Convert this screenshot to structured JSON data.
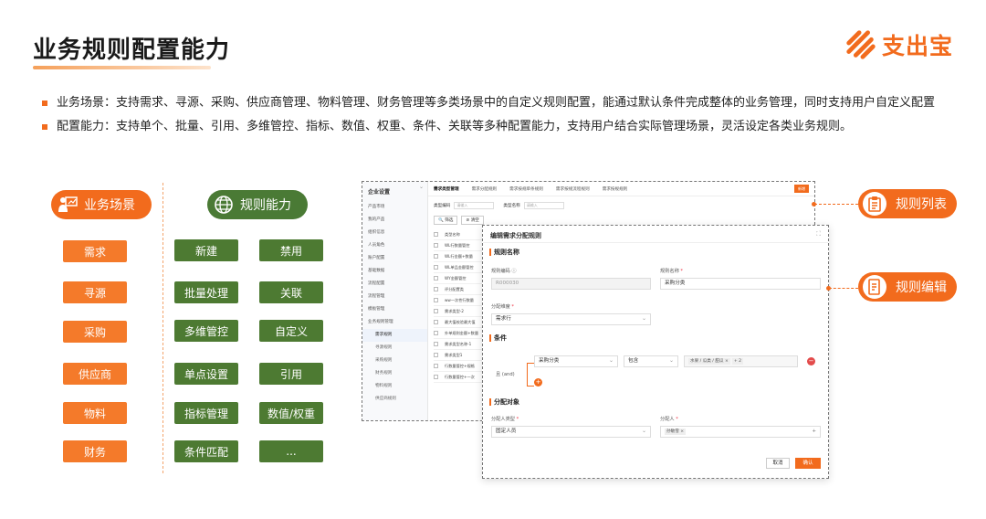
{
  "page": {
    "title": "业务规则配置能力",
    "logo_text": "支出宝"
  },
  "bullets": [
    "业务场景：支持需求、寻源、采购、供应商管理、物料管理、财务管理等多类场景中的自定义规则配置，能通过默认条件完成整体的业务管理，同时支持用户自定义配置",
    "配置能力：支持单个、批量、引用、多维管控、指标、数值、权重、条件、关联等多种配置能力，支持用户结合实际管理场景，灵活设定各类业务规则。"
  ],
  "scenes": {
    "header": "业务场景",
    "items": [
      "需求",
      "寻源",
      "采购",
      "供应商",
      "物料",
      "财务"
    ]
  },
  "capabilities": {
    "header": "规则能力",
    "left": [
      "新建",
      "批量处理",
      "多维管控",
      "单点设置",
      "指标管理",
      "条件匹配"
    ],
    "right": [
      "禁用",
      "关联",
      "自定义",
      "引用",
      "数值/权重",
      "..."
    ]
  },
  "callouts": {
    "list": "规则列表",
    "edit": "规则编辑"
  },
  "list_screen": {
    "sidebar_title": "企业设置",
    "sidebar_items": [
      "产品市场",
      "我的产品",
      "组织信息",
      "人员角色",
      "账户配置",
      "基础数据",
      "流程配置",
      "流程管理",
      "模板管理",
      "业务规则管理"
    ],
    "sidebar_sub": [
      "需求规则",
      "寻源规则",
      "采购规则",
      "财务规则",
      "物料规则",
      "供应商规则"
    ],
    "tabs": [
      "需求类型管理",
      "需求分配规则",
      "需求按规单条规则",
      "需求按规流程规则",
      "需求按规规则"
    ],
    "new_button": "新增",
    "filter_code_label": "类型编码",
    "filter_code_placeholder": "请输入",
    "filter_name_label": "类型名称",
    "filter_name_placeholder": "请输入",
    "search_button": "筛选",
    "clear_button": "清空",
    "rows": [
      "类型名称",
      "WL行数量管控",
      "WL行金额+数量",
      "WL单品金额管控",
      "WY金额管控",
      "评分配置类",
      "ww一次性行数量",
      "需求类型-2",
      "最大值校验最大值",
      "外单规则金额+数量",
      "需求类型名称-1",
      "需求类型1",
      "行数量管控+规格",
      "行数量管控+一次"
    ]
  },
  "edit_modal": {
    "title": "编辑需求分配规则",
    "section_name": "规则名称",
    "code_label": "规则编码",
    "code_value": "R000030",
    "name_label": "规则名称",
    "name_value": "采购分类",
    "dimension_label": "分配维度",
    "dimension_value": "需求行",
    "section_condition": "条件",
    "and_label": "且 (and)",
    "cond_field": "采购分类",
    "cond_op": "包含",
    "cond_tags": [
      "水果 / 瓜类 / 甜瓜",
      "+ 2"
    ],
    "section_target": "分配对象",
    "target_type_label": "分配人类型",
    "target_type_value": "固定人员",
    "assignee_label": "分配人",
    "assignee_tag": "孙敏雪",
    "cancel_button": "取消",
    "ok_button": "确认"
  },
  "colors": {
    "accent": "#f26b1d",
    "green": "#4d7a32"
  }
}
